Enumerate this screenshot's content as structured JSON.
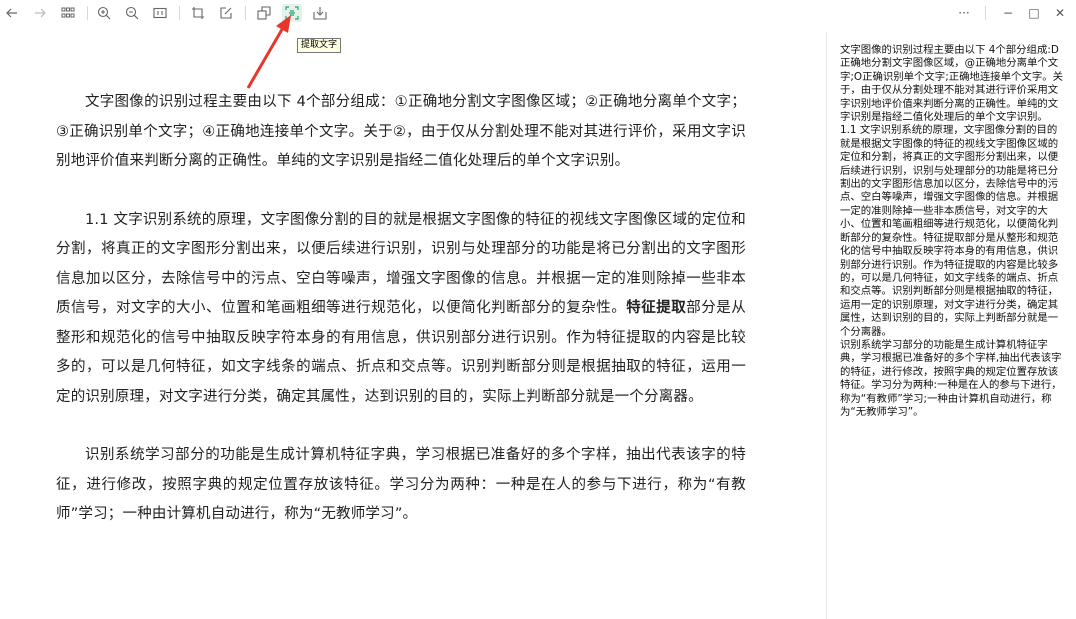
{
  "toolbar": {
    "items": [
      "back",
      "forward",
      "grid",
      "zoom-in",
      "zoom-out",
      "fit-width",
      "crop",
      "edit",
      "copy",
      "extract-text",
      "save"
    ],
    "more_label": "···",
    "minimize_label": "−",
    "maximize_label": "□",
    "close_label": "✕"
  },
  "tooltip": {
    "label": "提取文字"
  },
  "document": {
    "paragraphs": [
      "文字图像的识别过程主要由以下 4个部分组成：①正确地分割文字图像区域；②正确地分离单个文字；③正确识别单个文字；④正确地连接单个文字。关于②，由于仅从分割处理不能对其进行评价，采用文字识别地评价值来判断分离的正确性。单纯的文字识别是指经二值化处理后的单个文字识别。",
      "1.1 文字识别系统的原理，文字图像分割的目的就是根据文字图像的特征的视线文字图像区域的定位和分割，将真正的文字图形分割出来，以便后续进行识别，识别与处理部分的功能是将已分割出的文字图形信息加以区分，去除信号中的污点、空白等噪声，增强文字图像的信息。并根据一定的准则除掉一些非本质信号，对文字的大小、位置和笔画粗细等进行规范化，以便简化判断部分的复杂性。",
      "特征提取",
      "部分是从整形和规范化的信号中抽取反映字符本身的有用信息，供识别部分进行识别。作为特征提取的内容是比较多的，可以是几何特征，如文字线条的端点、折点和交点等。识别判断部分则是根据抽取的特征，运用一定的识别原理，对文字进行分类，确定其属性，达到识别的目的，实际上判断部分就是一个分离器。",
      "识别系统学习部分的功能是生成计算机特征字典，学习根据已准备好的多个字样，抽出代表该字的特征，进行修改，按照字典的规定位置存放该特征。学习分为两种：一种是在人的参与下进行，称为“有教师”学习；一种由计算机自动进行，称为“无教师学习”。"
    ]
  },
  "sidebar": {
    "paragraphs": [
      "文字图像的识别过程主要由以下 4个部分组成:D正确地分割文字图像区域，@正确地分离单个文字;O正确识别单个文字;正确地连接单个文字。关于，由于仅从分割处理不能对其进行评价采用文字识别地评价值来判断分离的正确性。单纯的文字识别是指经二值化处理后的单个文字识别。",
      "1.1 文字识别系统的原理，文字图像分割的目的就是根据文字图像的特征的视线文字图像区域的定位和分割，将真正的文字图形分割出来，以便后续进行识别，识别与处理部分的功能是将已分割出的文字图形信息加以区分，去除信号中的污点、空白等噪声，增强文字图像的信息。并根据一定的准则除掉一些非本质信号，对文字的大小、位置和笔画粗细等进行规范化，以便简化判断部分的复杂性。特征提取部分是从整形和规范化的信号中抽取反映字符本身的有用信息，供识别部分进行识别。作为特征提取的内容是比较多的，可以是几何特征，如文字线条的端点、折点和交点等。识别判断部分则是根据抽取的特征，运用一定的识别原理，对文字进行分类，确定其属性，达到识别的目的，实际上判断部分就是一个分离器。",
      "识别系统学习部分的功能是生成计算机特征字典，学习根据已准备好的多个字样,抽出代表该字的特征，进行修改，按照字典的规定位置存放该特征。学习分为两种:一种是在人的参与下进行，称为“有教师”学习;一种由计算机自动进行，称为“无教师学习”。"
    ]
  },
  "colors": {
    "active": "#2aa36b",
    "arrow": "#e8362d"
  }
}
